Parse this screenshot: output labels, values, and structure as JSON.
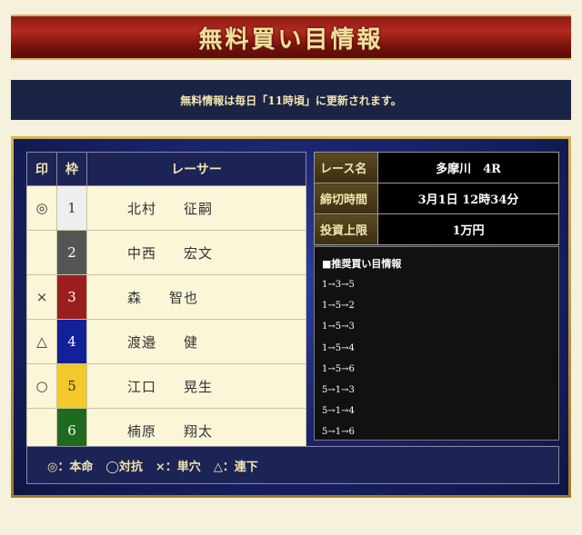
{
  "header": {
    "title": "無料買い目情報"
  },
  "notice": {
    "text": "無料情報は毎日「11時頃」に更新されます。"
  },
  "racer_table": {
    "headers": {
      "mark": "印",
      "waku": "枠",
      "racer": "レーサー"
    },
    "rows": [
      {
        "mark": "◎",
        "waku": "1",
        "surname": "北村",
        "given": "征嗣",
        "waku_bg": "#eeeeee",
        "waku_fg": "#333333"
      },
      {
        "mark": "",
        "waku": "2",
        "surname": "中西",
        "given": "宏文",
        "waku_bg": "#555555",
        "waku_fg": "#ffffff"
      },
      {
        "mark": "×",
        "waku": "3",
        "surname": "森",
        "given": "智也",
        "waku_bg": "#9a1e1e",
        "waku_fg": "#ffffff"
      },
      {
        "mark": "△",
        "waku": "4",
        "surname": "渡邉",
        "given": "健",
        "waku_bg": "#12209a",
        "waku_fg": "#ffffff"
      },
      {
        "mark": "○",
        "waku": "5",
        "surname": "江口",
        "given": "晃生",
        "waku_bg": "#f2c82a",
        "waku_fg": "#333333"
      },
      {
        "mark": "",
        "waku": "6",
        "surname": "楠原",
        "given": "翔太",
        "waku_bg": "#1e6a1e",
        "waku_fg": "#ffffff"
      }
    ]
  },
  "race_info": {
    "race_name_label": "レース名",
    "race_name": "多摩川　4R",
    "deadline_label": "締切時間",
    "deadline": "3月1日 12時34分",
    "budget_label": "投資上限",
    "budget": "1万円"
  },
  "recommendations": {
    "title": "■推奨買い目情報",
    "items": [
      "1→3→5",
      "1→5→2",
      "1→5→3",
      "1→5→4",
      "1→5→6",
      "5→1→3",
      "5→1→4",
      "5→1→6"
    ]
  },
  "legend": {
    "honmei": "◎：本命",
    "taikou": "◯対抗",
    "tanana": "×：単穴",
    "renka": "△：連下"
  }
}
